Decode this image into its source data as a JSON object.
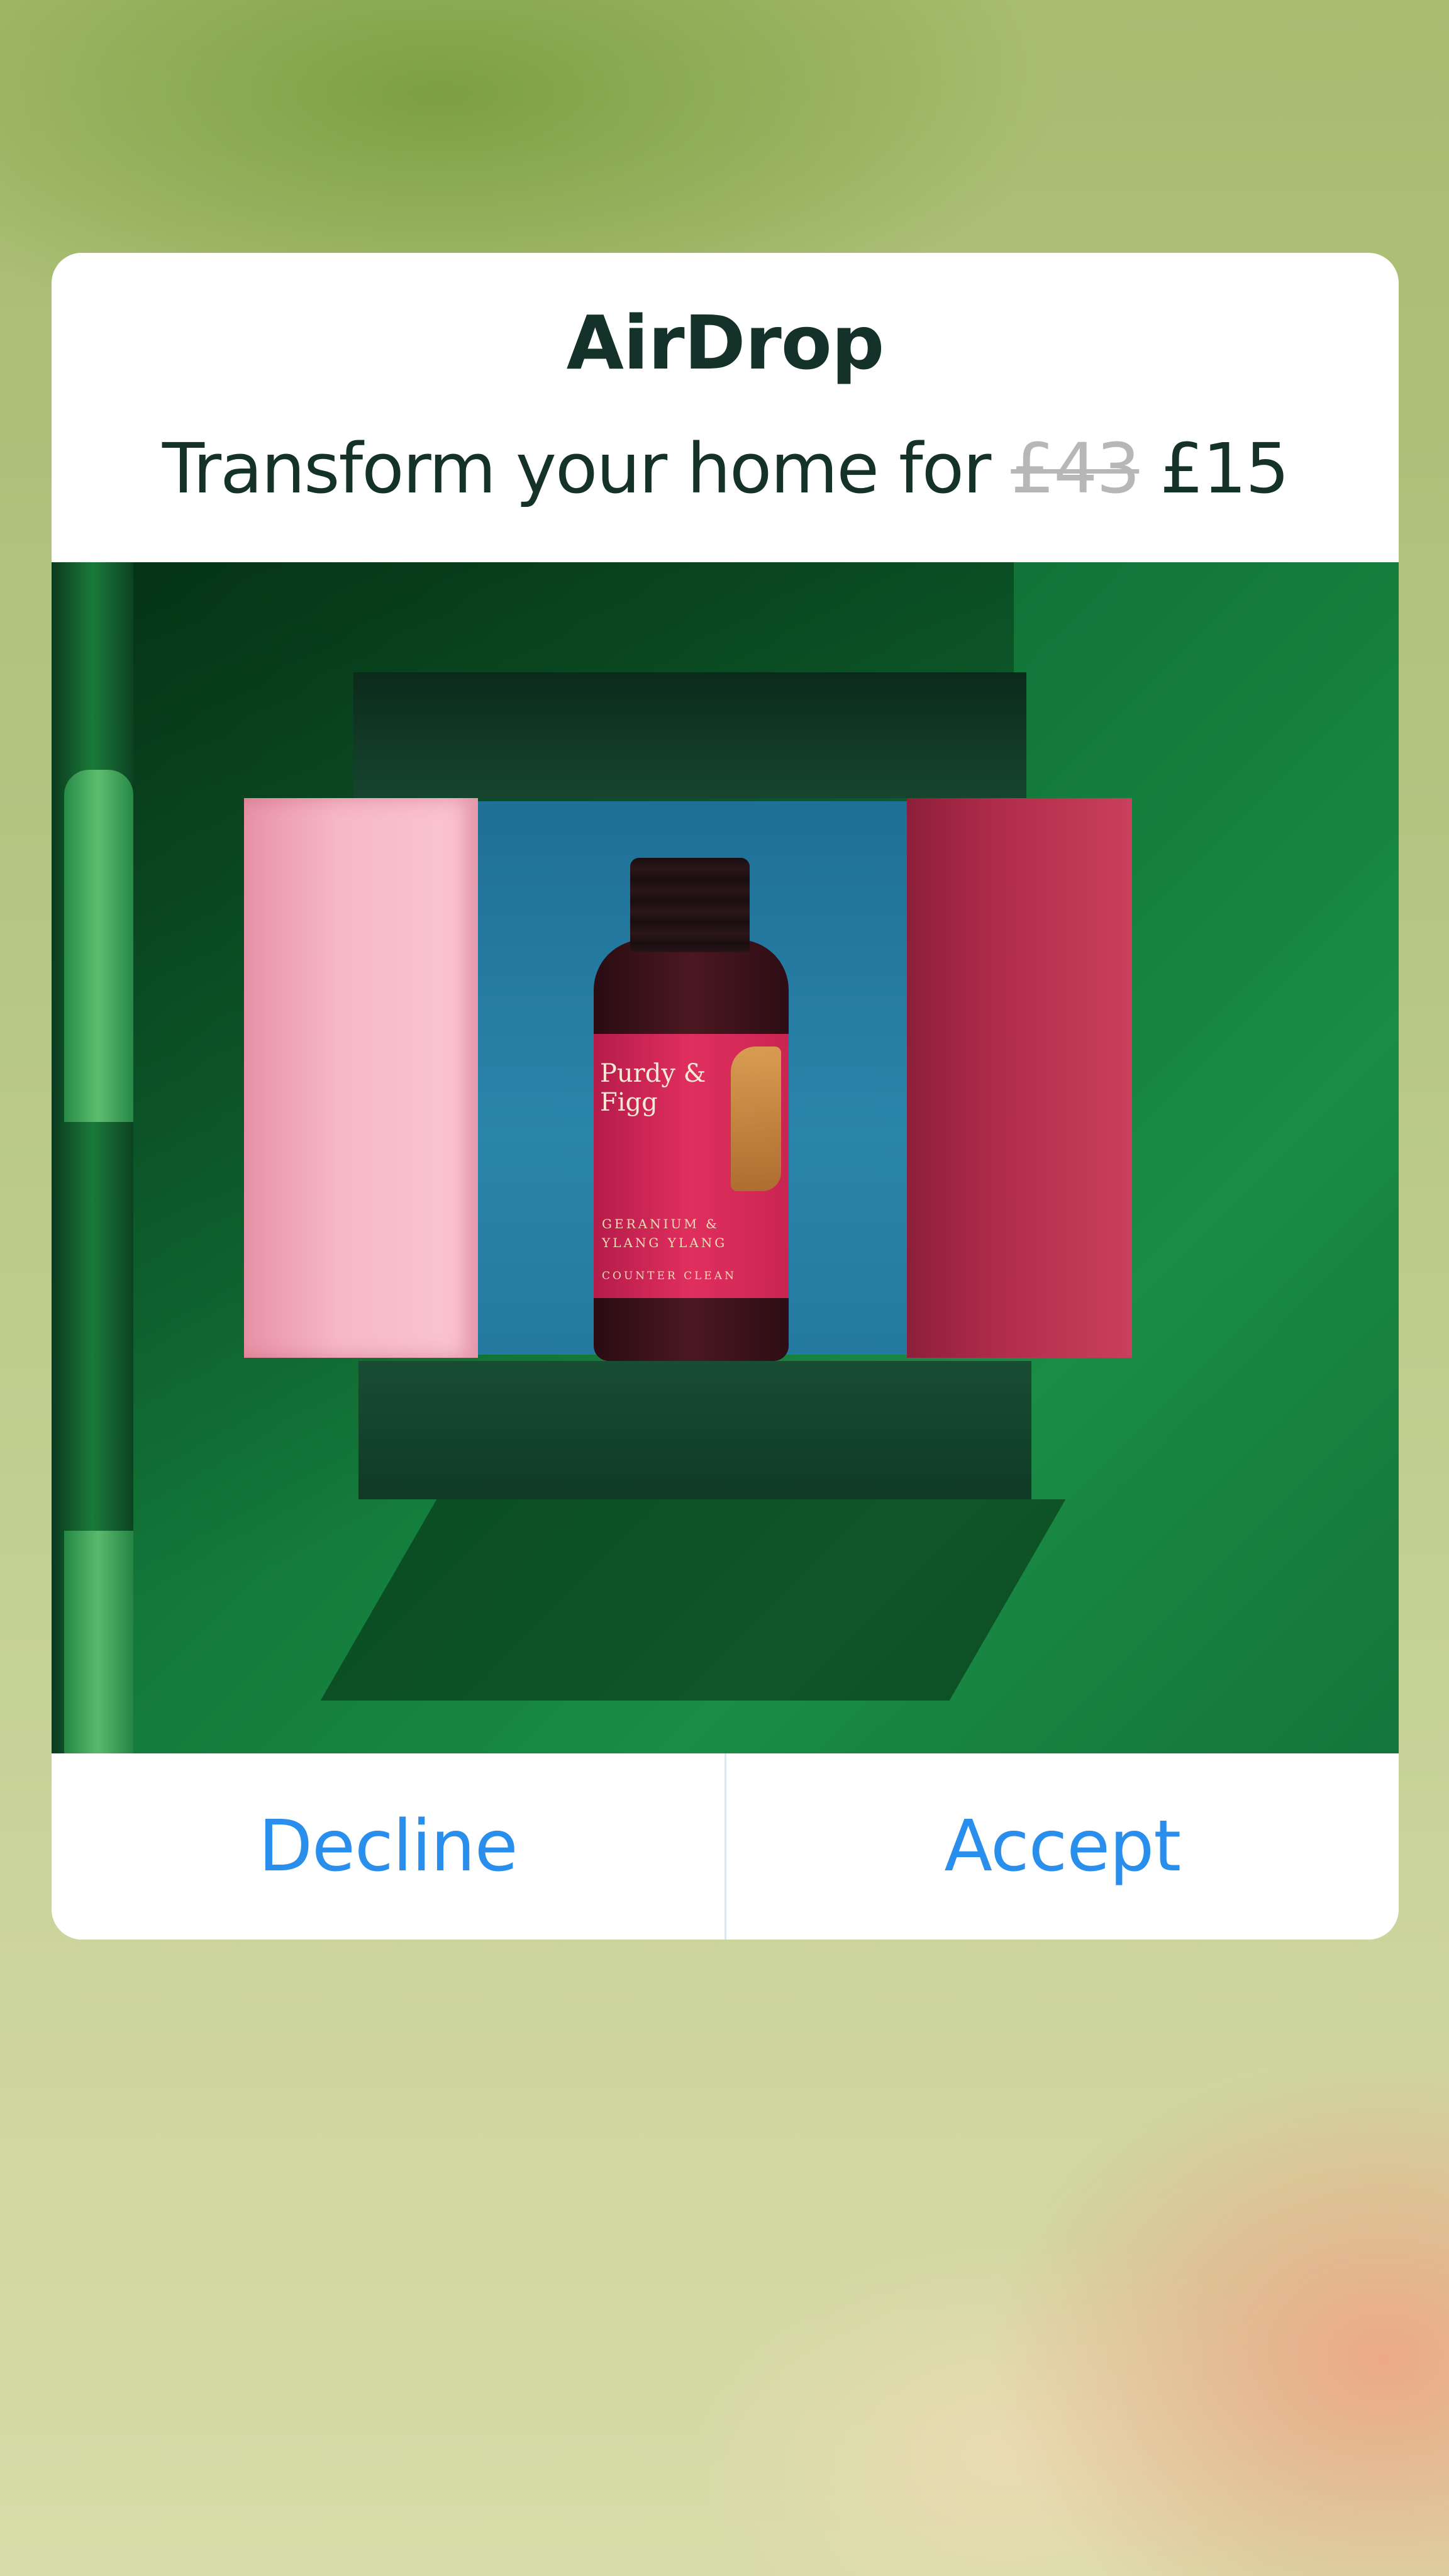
{
  "dialog": {
    "title": "AirDrop",
    "message_prefix": "Transform your home for",
    "old_price": "£43",
    "new_price": "£15"
  },
  "image": {
    "brand": "Purdy & Figg",
    "scent_line1": "GERANIUM &",
    "scent_line2": "YLANG YLANG",
    "product_line": "COUNTER CLEAN"
  },
  "actions": {
    "decline_label": "Decline",
    "accept_label": "Accept"
  },
  "colors": {
    "accent": "#2a8eed",
    "title_text": "#14312a",
    "strikethrough_price": "#b7b7b7"
  }
}
